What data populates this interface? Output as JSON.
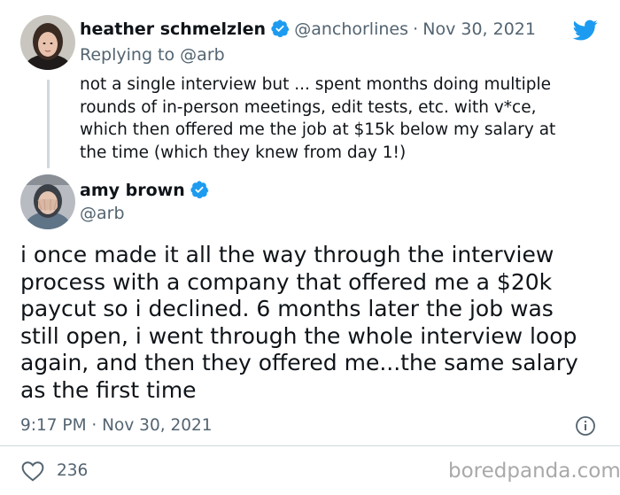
{
  "reply_tweet": {
    "author_name": "heather schmelzlen",
    "author_handle": "@anchorlines",
    "separator": "·",
    "date": "Nov 30, 2021",
    "replying_prefix": "Replying to",
    "replying_to": "@arb",
    "text_lines": [
      "not a single interview but ... spent months doing multiple",
      "rounds of in-person meetings, edit tests, etc. with v*ce,",
      "which then offered me the job at $15k below my salary at",
      "the time (which they knew from day 1!)"
    ]
  },
  "main_tweet": {
    "author_name": "amy brown",
    "author_handle": "@arb",
    "text_lines": [
      "i once made it all the way through the interview",
      "process with a company that offered me a $20k",
      "paycut so i declined. 6 months later the job was",
      "still open, i went through the whole interview loop",
      "again, and then they offered me...the same salary",
      "as the first time"
    ],
    "timestamp": "9:17 PM · Nov 30, 2021",
    "like_count": "236"
  },
  "watermark": "boredpanda.com",
  "colors": {
    "twitter_blue": "#1d9bf0",
    "text": "#0f1419",
    "secondary": "#536471"
  }
}
